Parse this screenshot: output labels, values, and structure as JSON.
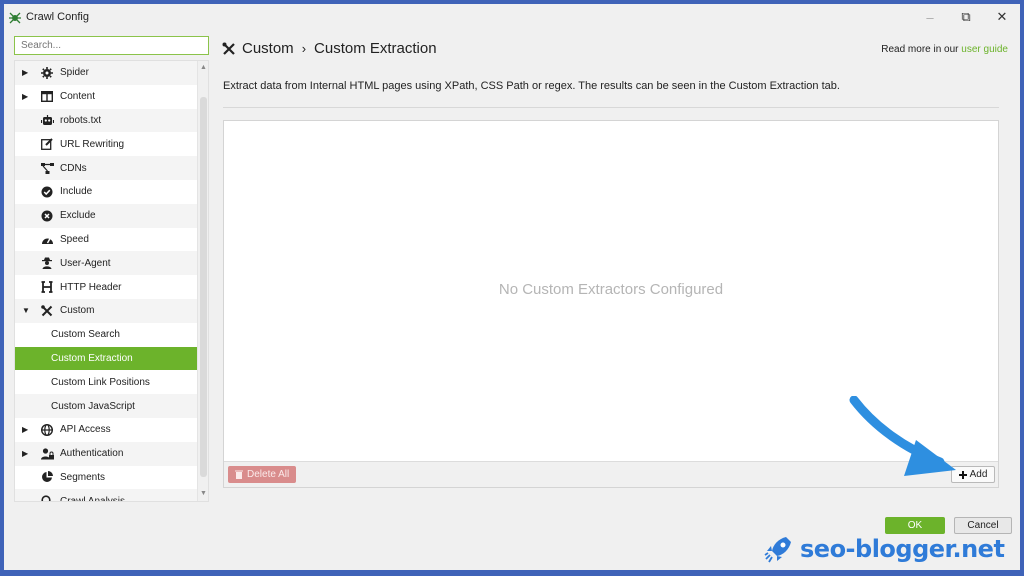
{
  "window": {
    "title": "Crawl Config",
    "controls": {
      "minimize": "–",
      "restore": "⧉",
      "close": "✕"
    }
  },
  "sidebar": {
    "search_placeholder": "Search...",
    "items": [
      {
        "label": "Spider",
        "icon": "gear-icon",
        "expandable": true,
        "expanded": false
      },
      {
        "label": "Content",
        "icon": "columns-icon",
        "expandable": true,
        "expanded": false
      },
      {
        "label": "robots.txt",
        "icon": "robot-icon",
        "expandable": false
      },
      {
        "label": "URL Rewriting",
        "icon": "edit-icon",
        "expandable": false
      },
      {
        "label": "CDNs",
        "icon": "network-icon",
        "expandable": false
      },
      {
        "label": "Include",
        "icon": "check-circle-icon",
        "expandable": false
      },
      {
        "label": "Exclude",
        "icon": "x-circle-icon",
        "expandable": false
      },
      {
        "label": "Speed",
        "icon": "speedometer-icon",
        "expandable": false
      },
      {
        "label": "User-Agent",
        "icon": "user-secret-icon",
        "expandable": false
      },
      {
        "label": "HTTP Header",
        "icon": "header-icon",
        "expandable": false
      },
      {
        "label": "Custom",
        "icon": "tools-icon",
        "expandable": true,
        "expanded": true
      },
      {
        "label": "Custom Search",
        "child": true
      },
      {
        "label": "Custom Extraction",
        "child": true,
        "selected": true
      },
      {
        "label": "Custom Link Positions",
        "child": true
      },
      {
        "label": "Custom JavaScript",
        "child": true
      },
      {
        "label": "API Access",
        "icon": "globe-icon",
        "expandable": true,
        "expanded": false
      },
      {
        "label": "Authentication",
        "icon": "user-lock-icon",
        "expandable": true,
        "expanded": false
      },
      {
        "label": "Segments",
        "icon": "pie-chart-icon",
        "expandable": false
      },
      {
        "label": "Crawl Analysis",
        "icon": "search-icon",
        "expandable": false
      }
    ]
  },
  "header": {
    "crumb_parent": "Custom",
    "crumb_separator": "›",
    "crumb_current": "Custom Extraction",
    "guide_prefix": "Read more in our",
    "guide_link": "user guide"
  },
  "main": {
    "description": "Extract data from Internal HTML pages using XPath, CSS Path or regex. The results can be seen in the Custom Extraction tab.",
    "empty_message": "No Custom Extractors Configured",
    "delete_all_label": "Delete All",
    "add_label": "Add"
  },
  "footer": {
    "ok_label": "OK",
    "cancel_label": "Cancel"
  },
  "watermark": {
    "text": "seo-blogger.net"
  },
  "colors": {
    "accent": "#6cb32b",
    "delete_button": "#d98c8c",
    "frame": "#3f63b8",
    "watermark": "#2f7bd8",
    "annotation_arrow": "#2e8fe0"
  }
}
